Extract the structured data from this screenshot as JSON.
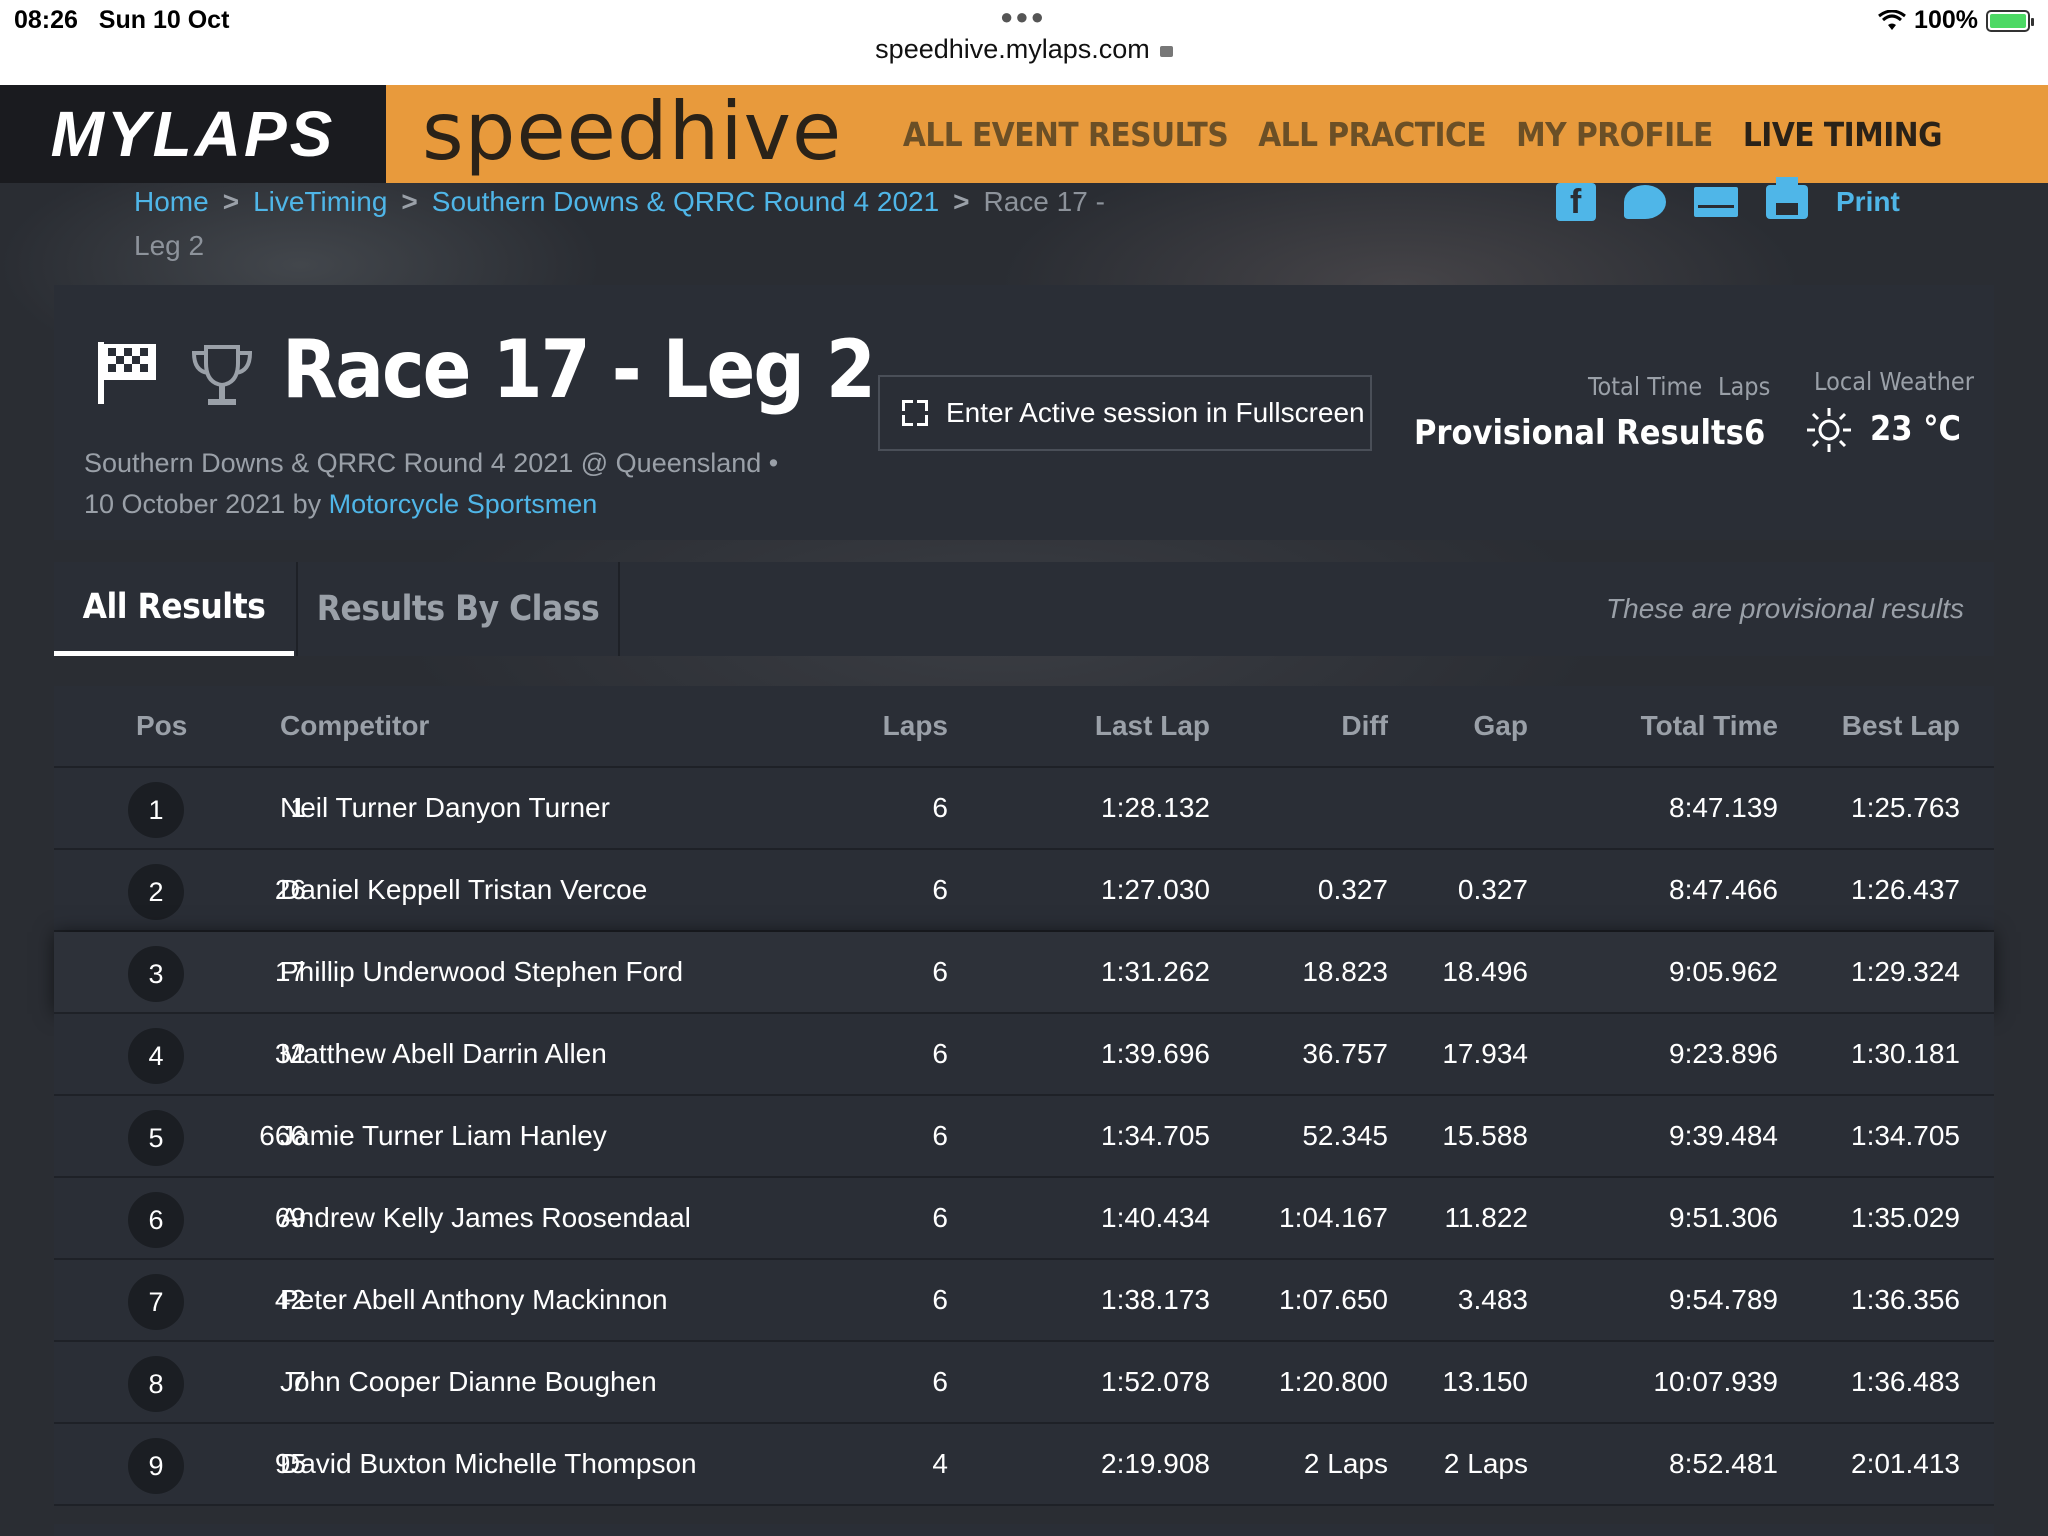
{
  "status": {
    "time": "08:26",
    "date": "Sun 10 Oct",
    "url": "speedhive.mylaps.com",
    "battery": "100%"
  },
  "nav": {
    "brand": "MYLAPS",
    "product": "speedhive",
    "links": [
      "ALL EVENT RESULTS",
      "ALL PRACTICE",
      "MY PROFILE",
      "LIVE TIMING"
    ],
    "active_link": "LIVE TIMING",
    "accent": "#e89a3c"
  },
  "breadcrumb": {
    "home": "Home",
    "livetiming": "LiveTiming",
    "event": "Southern Downs & QRRC Round 4 2021",
    "current_a": "Race 17 -",
    "current_b": "Leg 2"
  },
  "share": {
    "print": "Print",
    "icons": [
      "facebook-icon",
      "twitter-icon",
      "mail-icon",
      "printer-icon"
    ]
  },
  "session": {
    "title": "Race 17 - Leg 2",
    "subtitle_a": "Southern Downs & QRRC Round 4 2021 @ Queensland •",
    "subtitle_b": "10 October 2021 by ",
    "organizer": "Motorcycle Sportsmen",
    "fullscreen_label": "Enter Active session in Fullscreen",
    "total_time_label": "Total Time",
    "total_time_value": "Provisional Results",
    "laps_label": "Laps",
    "laps_value": "6",
    "weather_label": "Local Weather",
    "weather_value": "23 °C"
  },
  "tabs": {
    "all": "All Results",
    "by_class": "Results By Class",
    "note": "These are provisional results"
  },
  "table": {
    "headers": {
      "pos": "Pos",
      "competitor": "Competitor",
      "laps": "Laps",
      "last_lap": "Last Lap",
      "diff": "Diff",
      "gap": "Gap",
      "total_time": "Total Time",
      "best_lap": "Best Lap"
    },
    "rows": [
      {
        "pos": "1",
        "num": "1",
        "name": "Neil Turner Danyon Turner",
        "laps": "6",
        "last": "1:28.132",
        "diff": "",
        "gap": "",
        "total": "8:47.139",
        "best": "1:25.763"
      },
      {
        "pos": "2",
        "num": "26",
        "name": "Daniel Keppell Tristan Vercoe",
        "laps": "6",
        "last": "1:27.030",
        "diff": "0.327",
        "gap": "0.327",
        "total": "8:47.466",
        "best": "1:26.437"
      },
      {
        "pos": "3",
        "num": "17",
        "name": "Phillip Underwood Stephen Ford",
        "laps": "6",
        "last": "1:31.262",
        "diff": "18.823",
        "gap": "18.496",
        "total": "9:05.962",
        "best": "1:29.324"
      },
      {
        "pos": "4",
        "num": "32",
        "name": "Matthew Abell Darrin Allen",
        "laps": "6",
        "last": "1:39.696",
        "diff": "36.757",
        "gap": "17.934",
        "total": "9:23.896",
        "best": "1:30.181"
      },
      {
        "pos": "5",
        "num": "666",
        "name": "Jamie Turner Liam Hanley",
        "laps": "6",
        "last": "1:34.705",
        "diff": "52.345",
        "gap": "15.588",
        "total": "9:39.484",
        "best": "1:34.705"
      },
      {
        "pos": "6",
        "num": "69",
        "name": "Andrew Kelly James Roosendaal",
        "laps": "6",
        "last": "1:40.434",
        "diff": "1:04.167",
        "gap": "11.822",
        "total": "9:51.306",
        "best": "1:35.029"
      },
      {
        "pos": "7",
        "num": "42",
        "name": "Peter Abell Anthony Mackinnon",
        "laps": "6",
        "last": "1:38.173",
        "diff": "1:07.650",
        "gap": "3.483",
        "total": "9:54.789",
        "best": "1:36.356"
      },
      {
        "pos": "8",
        "num": "7",
        "name": "John Cooper Dianne Boughen",
        "laps": "6",
        "last": "1:52.078",
        "diff": "1:20.800",
        "gap": "13.150",
        "total": "10:07.939",
        "best": "1:36.483"
      },
      {
        "pos": "9",
        "num": "95",
        "name": "David Buxton Michelle Thompson",
        "laps": "4",
        "last": "2:19.908",
        "diff": "2 Laps",
        "gap": "2 Laps",
        "total": "8:52.481",
        "best": "2:01.413"
      }
    ]
  }
}
